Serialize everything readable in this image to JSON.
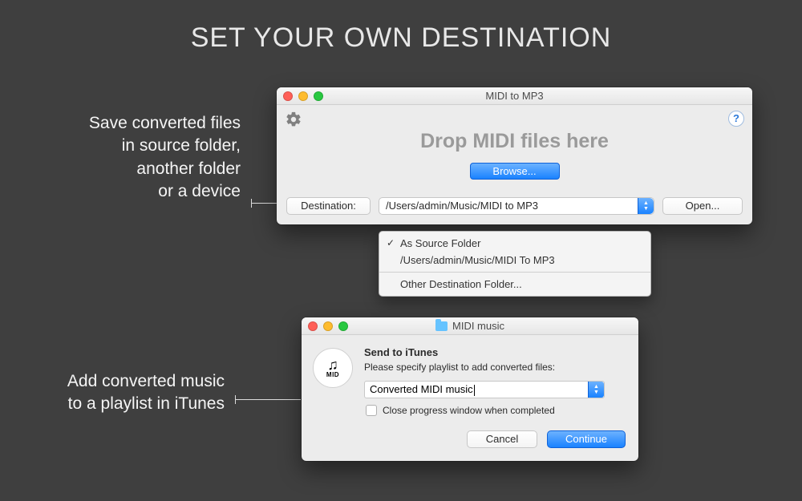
{
  "page": {
    "title": "SET YOUR OWN DESTINATION"
  },
  "caption1": {
    "line1": "Save converted files",
    "line2": "in source folder,",
    "line3": "another folder",
    "line4": "or a device"
  },
  "caption2": {
    "line1": "Add converted music",
    "line2": "to a playlist in iTunes"
  },
  "win1": {
    "title": "MIDI to MP3",
    "help_symbol": "?",
    "drop_label": "Drop MIDI files here",
    "browse_label": "Browse...",
    "destination_btn": "Destination:",
    "destination_path": "/Users/admin/Music/MIDI to MP3",
    "open_label": "Open..."
  },
  "menu": {
    "item_as_source": "As Source Folder",
    "item_path": "/Users/admin/Music/MIDI To MP3",
    "item_other": "Other Destination Folder..."
  },
  "win2": {
    "title": "MIDI music",
    "icon_label": "MID",
    "icon_notes": "♫",
    "heading": "Send to iTunes",
    "subtext": "Please specify playlist to add converted files:",
    "playlist_value": "Converted MIDI music",
    "checkbox_label": "Close progress window when completed",
    "cancel_label": "Cancel",
    "continue_label": "Continue"
  }
}
